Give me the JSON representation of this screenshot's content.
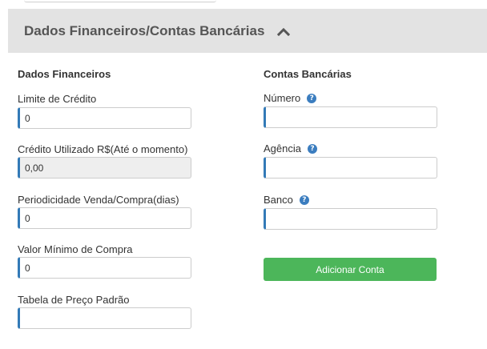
{
  "panel": {
    "title": "Dados Financeiros/Contas Bancárias"
  },
  "financial": {
    "section_title": "Dados Financeiros",
    "fields": [
      {
        "label": "Limite de Crédito",
        "value": "0"
      },
      {
        "label": "Crédito Utilizado R$(Até o momento)",
        "value": "0,00"
      },
      {
        "label": "Periodicidade Venda/Compra(dias)",
        "value": "0"
      },
      {
        "label": "Valor Mínimo de Compra",
        "value": "0"
      },
      {
        "label": "Tabela de Preço Padrão",
        "value": ""
      }
    ]
  },
  "bank": {
    "section_title": "Contas Bancárias",
    "fields": [
      {
        "label": "Número",
        "value": ""
      },
      {
        "label": "Agência",
        "value": ""
      },
      {
        "label": "Banco",
        "value": ""
      }
    ],
    "add_button_label": "Adicionar Conta",
    "button_color": "#4cb65a"
  },
  "colors": {
    "accent": "#337ab7",
    "help_icon": "#3b7dbf",
    "header_bg": "#e3e3e3"
  }
}
